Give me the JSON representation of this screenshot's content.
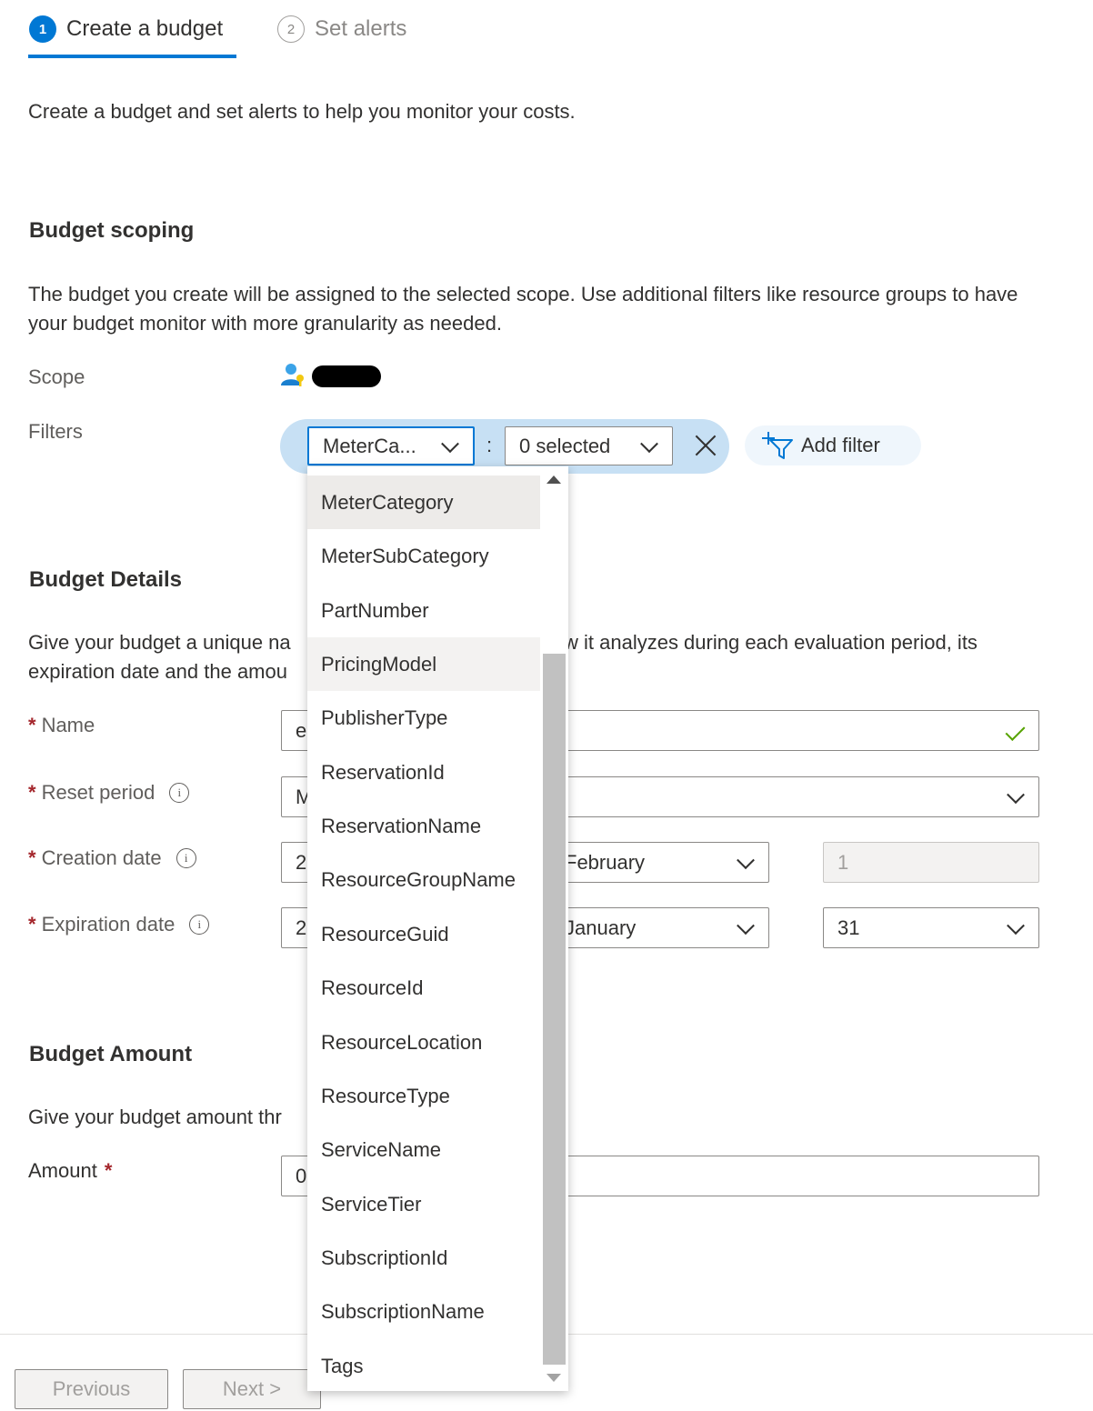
{
  "steps": [
    {
      "number": "1",
      "label": "Create a budget",
      "active": true
    },
    {
      "number": "2",
      "label": "Set alerts",
      "active": false
    }
  ],
  "intro": "Create a budget and set alerts to help you monitor your costs.",
  "scoping": {
    "title": "Budget scoping",
    "description": "The budget you create will be assigned to the selected scope. Use additional filters like resource groups to have your budget monitor with more granularity as needed.",
    "scope_label": "Scope",
    "filters_label": "Filters",
    "filter_dimension": "MeterCa...",
    "filter_colon": ":",
    "filter_values": "0 selected",
    "add_filter_label": "Add filter"
  },
  "details": {
    "title": "Budget Details",
    "description_left": "Give your budget a unique na",
    "description_right": "w it analyzes during each evaluation period, its",
    "description_line2": "expiration date and the amou",
    "name_label": "Name",
    "name_value": "e",
    "reset_label": "Reset period",
    "reset_value": "M",
    "creation_label": "Creation date",
    "creation_year": "2",
    "creation_month": "February",
    "creation_day": "1",
    "expiration_label": "Expiration date",
    "expiration_year": "2",
    "expiration_month": "January",
    "expiration_day": "31",
    "required_mark": "*",
    "info_glyph": "i"
  },
  "amount": {
    "title": "Budget Amount",
    "description": "Give your budget amount thr",
    "amount_label": "Amount",
    "amount_value": "0"
  },
  "dropdown": {
    "items": [
      "MeterCategory",
      "MeterSubCategory",
      "PartNumber",
      "PricingModel",
      "PublisherType",
      "ReservationId",
      "ReservationName",
      "ResourceGroupName",
      "ResourceGuid",
      "ResourceId",
      "ResourceLocation",
      "ResourceType",
      "ServiceName",
      "ServiceTier",
      "SubscriptionId",
      "SubscriptionName",
      "Tags"
    ],
    "selected": "MeterCategory",
    "hovered": "PricingModel"
  },
  "footer": {
    "previous_label": "Previous",
    "next_label": "Next >"
  },
  "colors": {
    "accent": "#0078d4",
    "required": "#a4262c",
    "valid": "#57a300",
    "filter_pill": "#c7e0f4"
  }
}
